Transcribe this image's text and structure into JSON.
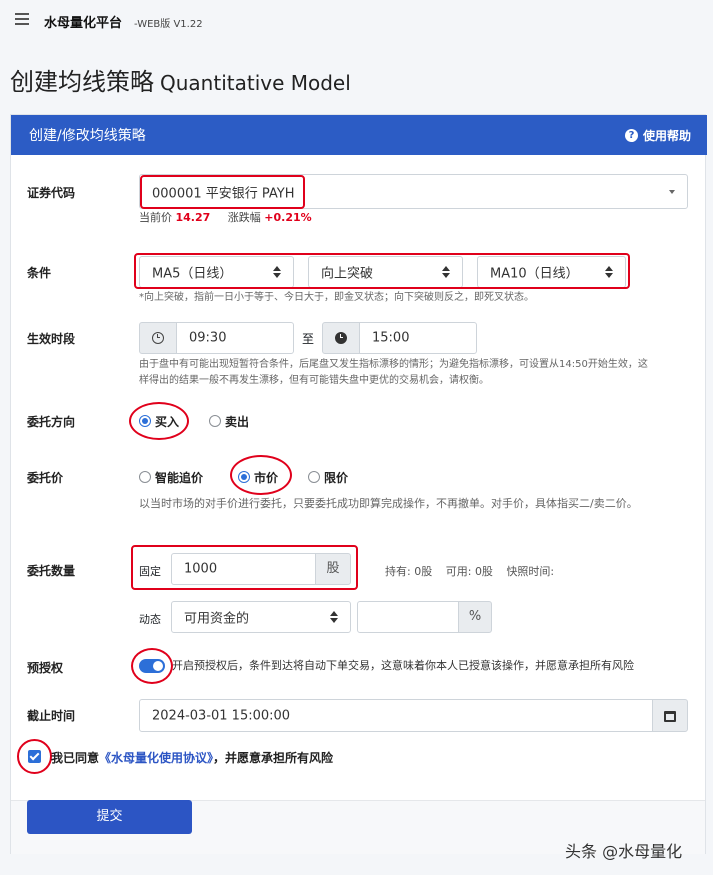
{
  "app": {
    "title": "水母量化平台",
    "version": "-WEB版 V1.22"
  },
  "page": {
    "title": "创建均线策略",
    "subtitle": "Quantitative Model"
  },
  "card": {
    "header": "创建/修改均线策略",
    "help": "使用帮助"
  },
  "security": {
    "label": "证券代码",
    "value": "000001 平安银行 PAYH",
    "price_label": "当前价",
    "price": "14.27",
    "change_label": "涨跌幅",
    "change": "+0.21%"
  },
  "condition": {
    "label": "条件",
    "ma_left": "MA5（日线）",
    "cross": "向上突破",
    "ma_right": "MA10（日线）",
    "hint": "*向上突破，指前一日小于等于、今日大于，即金叉状态；向下突破则反之，即死叉状态。"
  },
  "period": {
    "label": "生效时段",
    "start": "09:30",
    "to": "至",
    "end": "15:00",
    "hint_1": "由于盘中有可能出现短暂符合条件，后尾盘又发生指标漂移的情形；为避免指标漂移，可设置从14:50开始生效，这",
    "hint_2": "样得出的结果一般不再发生漂移，但有可能错失盘中更优的交易机会，请权衡。"
  },
  "direction": {
    "label": "委托方向",
    "buy": "买入",
    "sell": "卖出",
    "selected": "买入"
  },
  "price_type": {
    "label": "委托价",
    "smart": "智能追价",
    "market": "市价",
    "limit": "限价",
    "selected": "市价",
    "hint": "以当时市场的对手价进行委托，只要委托成功即算完成操作，不再撤单。对手价，具体指买二/卖二价。"
  },
  "quantity": {
    "label": "委托数量",
    "fixed_label": "固定",
    "value": "1000",
    "unit": "股",
    "hold_label": "持有:",
    "hold": "0股",
    "avail_label": "可用:",
    "avail": "0股",
    "snapshot_label": "快照时间:",
    "dynamic_label": "动态",
    "dynamic_select": "可用资金的",
    "percent_value": "",
    "percent_unit": "%"
  },
  "preauth": {
    "label": "预授权",
    "enabled": true,
    "text": "开启预授权后，条件到达将自动下单交易，这意味着你本人已授意该操作，并愿意承担所有风险"
  },
  "deadline": {
    "label": "截止时间",
    "value": "2024-03-01 15:00:00"
  },
  "agreement": {
    "checked": true,
    "prefix": "我已同意",
    "link": "《水母量化使用协议》",
    "suffix": "，并愿意承担所有风险"
  },
  "submit": "提交",
  "watermark": "头条 @水母量化",
  "colors": {
    "brand": "#2c5cc5",
    "up": "#e0001b",
    "annotation": "#e0001b"
  }
}
